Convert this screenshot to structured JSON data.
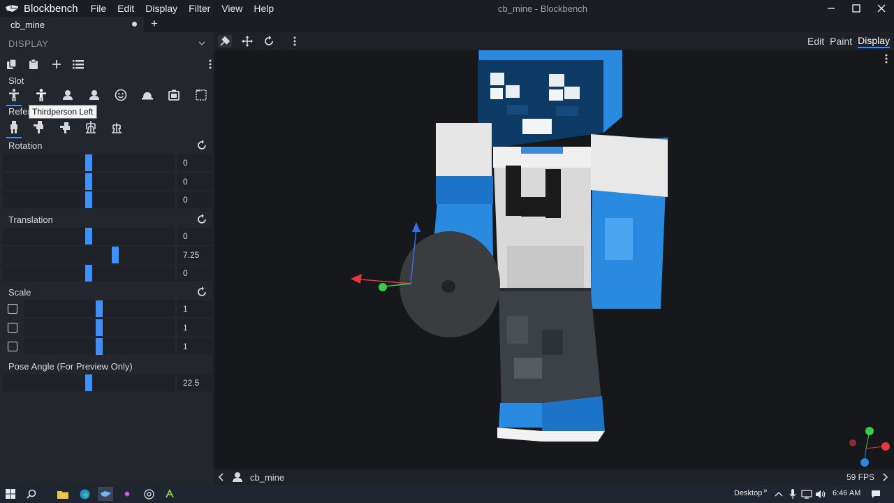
{
  "app": {
    "name": "Blockbench",
    "window_title": "cb_mine - Blockbench",
    "menu": [
      "File",
      "Edit",
      "Display",
      "Filter",
      "View",
      "Help"
    ]
  },
  "tabs": [
    {
      "label": "cb_mine",
      "unsaved": true
    }
  ],
  "panel": {
    "title": "DISPLAY",
    "slot_label": "Slot",
    "reference_label": "Refer",
    "tooltip": "Thirdperson Left",
    "rotation_label": "Rotation",
    "translation_label": "Translation",
    "scale_label": "Scale",
    "pose_label": "Pose Angle (For Preview Only)",
    "rotation": [
      "0",
      "0",
      "0"
    ],
    "translation": [
      "0",
      "7.25",
      "0"
    ],
    "scale": [
      "1",
      "1",
      "1"
    ],
    "pose_angle": "22.5",
    "rotation_frac": [
      0.5,
      0.5,
      0.5
    ],
    "translation_frac": [
      0.5,
      0.7,
      0.5
    ],
    "scale_frac": [
      0.5,
      0.5,
      0.5
    ],
    "pose_frac": 0.5
  },
  "viewport": {
    "modes": [
      "Edit",
      "Paint",
      "Display"
    ],
    "active_mode": "Display"
  },
  "status": {
    "model_name": "cb_mine",
    "fps": "59 FPS"
  },
  "taskbar": {
    "desktop_label": "Desktop",
    "time": "6:46 AM"
  },
  "colors": {
    "accent": "#3e90ff",
    "panel": "#23262d",
    "viewport": "#16181c"
  }
}
